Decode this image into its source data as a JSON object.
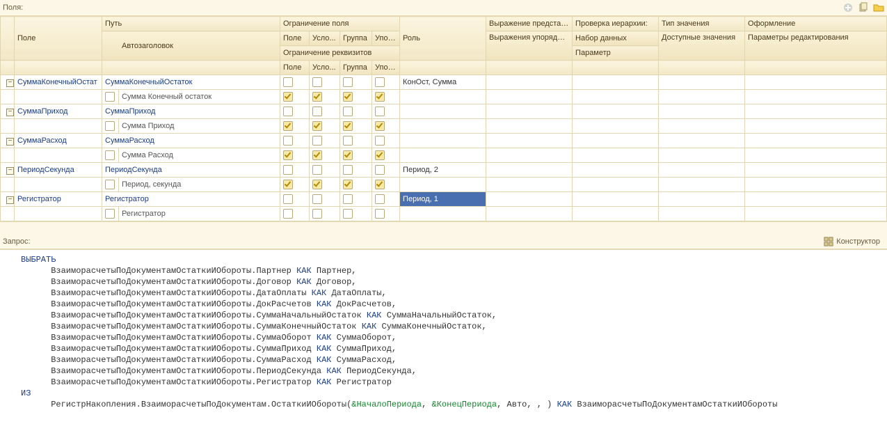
{
  "labels": {
    "fields": "Поля:",
    "query": "Запрос:",
    "konstruktor": "Конструктор"
  },
  "headers": {
    "pole": "Поле",
    "put": "Путь",
    "avtozag": "Автозаголовок",
    "ogr_polya": "Ограничение поля",
    "ogr_rekv": "Ограничение реквизитов",
    "sub_pole": "Поле",
    "sub_uslo": "Усло...",
    "sub_gruppa": "Группа",
    "sub_upor": "Упор...",
    "rol": "Роль",
    "vyrazh_predstav": "Выражение представ...",
    "vyrazh_uporyad": "Выражения упорядочивания",
    "proverka": "Проверка иерархии:",
    "nabor": "Набор данных",
    "parametr": "Параметр",
    "tip_znach": "Тип значения",
    "dostup": "Доступные значения",
    "oformlenie": "Оформление",
    "param_redakt": "Параметры редактирования"
  },
  "rows": [
    {
      "field": "СуммаКонечныйОстат",
      "path": "СуммаКонечныйОстаток",
      "title": "Сумма Конечный остаток",
      "role": "КонОст, Сумма",
      "r1": [
        0,
        0,
        0,
        0
      ],
      "r2": [
        1,
        1,
        1,
        1
      ]
    },
    {
      "field": "СуммаПриход",
      "path": "СуммаПриход",
      "title": "Сумма Приход",
      "role": "",
      "r1": [
        0,
        0,
        0,
        0
      ],
      "r2": [
        1,
        1,
        1,
        1
      ]
    },
    {
      "field": "СуммаРасход",
      "path": "СуммаРасход",
      "title": "Сумма Расход",
      "role": "",
      "r1": [
        0,
        0,
        0,
        0
      ],
      "r2": [
        1,
        1,
        1,
        1
      ]
    },
    {
      "field": "ПериодСекунда",
      "path": "ПериодСекунда",
      "title": "Период, секунда",
      "role": "Период, 2",
      "r1": [
        0,
        0,
        0,
        0
      ],
      "r2": [
        1,
        1,
        1,
        1
      ]
    },
    {
      "field": "Регистратор",
      "path": "Регистратор",
      "title": "Регистратор",
      "role": "Период, 1",
      "selected": true,
      "r1": [
        0,
        0,
        0,
        0
      ],
      "r2": [
        0,
        0,
        0,
        0
      ]
    }
  ],
  "query": {
    "select": "ВЫБРАТЬ",
    "lines": [
      [
        "ВзаиморасчетыПоДокументамОстаткиИОбороты.Партнер ",
        "КАК",
        " Партнер,"
      ],
      [
        "ВзаиморасчетыПоДокументамОстаткиИОбороты.Договор ",
        "КАК",
        " Договор,"
      ],
      [
        "ВзаиморасчетыПоДокументамОстаткиИОбороты.ДатаОплаты ",
        "КАК",
        " ДатаОплаты,"
      ],
      [
        "ВзаиморасчетыПоДокументамОстаткиИОбороты.ДокРасчетов ",
        "КАК",
        " ДокРасчетов,"
      ],
      [
        "ВзаиморасчетыПоДокументамОстаткиИОбороты.СуммаНачальныйОстаток ",
        "КАК",
        " СуммаНачальныйОстаток,"
      ],
      [
        "ВзаиморасчетыПоДокументамОстаткиИОбороты.СуммаКонечныйОстаток ",
        "КАК",
        " СуммаКонечныйОстаток,"
      ],
      [
        "ВзаиморасчетыПоДокументамОстаткиИОбороты.СуммаОборот ",
        "КАК",
        " СуммаОборот,"
      ],
      [
        "ВзаиморасчетыПоДокументамОстаткиИОбороты.СуммаПриход ",
        "КАК",
        " СуммаПриход,"
      ],
      [
        "ВзаиморасчетыПоДокументамОстаткиИОбороты.СуммаРасход ",
        "КАК",
        " СуммаРасход,"
      ],
      [
        "ВзаиморасчетыПоДокументамОстаткиИОбороты.ПериодСекунда ",
        "КАК",
        " ПериодСекунда,"
      ],
      [
        "ВзаиморасчетыПоДокументамОстаткиИОбороты.Регистратор ",
        "КАК",
        " Регистратор"
      ]
    ],
    "from": "ИЗ",
    "from_line_pre": "РегистрНакопления.ВзаиморасчетыПоДокументам.ОстаткиИОбороты(",
    "p1": "&НачалоПериода",
    "sep1": ", ",
    "p2": "&КонецПериода",
    "from_line_mid": ", Авто, , ) ",
    "kak": "КАК",
    "from_line_post": " ВзаиморасчетыПоДокументамОстаткиИОбороты"
  }
}
